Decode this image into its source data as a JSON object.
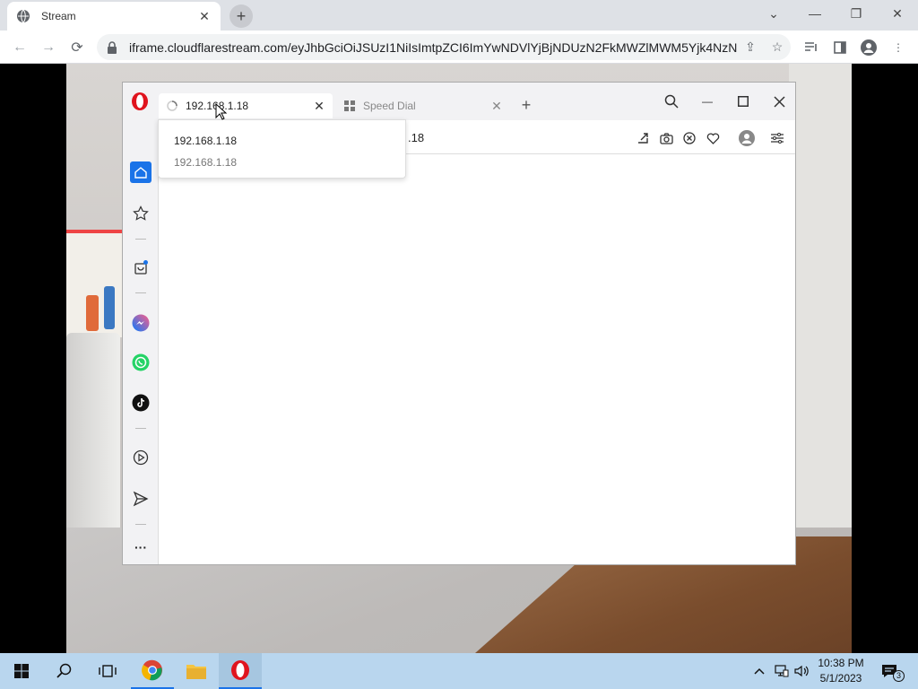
{
  "chrome": {
    "tab_title": "Stream",
    "url": "iframe.cloudflarestream.com/eyJhbGciOiJSUzI1NiIsImtpZCI6ImYwNDVlYjBjNDUzN2FkMWZlMWM5Yjk4NzN..."
  },
  "opera": {
    "tabs": [
      {
        "label": "192.168.1.18",
        "active": true
      },
      {
        "label": "Speed Dial",
        "active": false
      }
    ],
    "address_text": ".18",
    "dropdown": {
      "primary": "192.168.1.18",
      "secondary": "192.168.1.18"
    }
  },
  "taskbar": {
    "time": "10:38 PM",
    "date": "5/1/2023",
    "notification_count": "3"
  },
  "colors": {
    "opera_red": "#e0141e",
    "accent_blue": "#1a73e8",
    "taskbar_bg": "#b9d6ee"
  }
}
